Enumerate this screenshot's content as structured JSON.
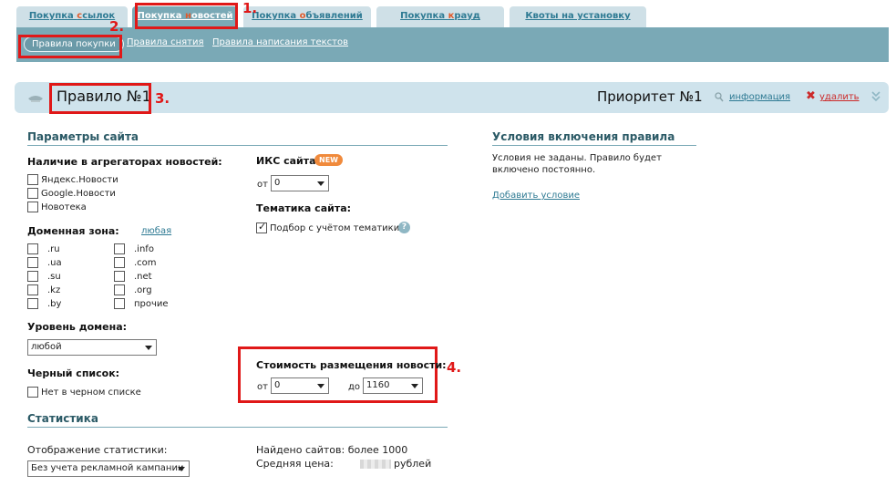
{
  "tabs": [
    {
      "pre": "Покупка ",
      "hl": "с",
      "post": "сылок"
    },
    {
      "pre": "Покупка ",
      "hl": "н",
      "post": "овостей"
    },
    {
      "pre": "Покупка ",
      "hl": "о",
      "post": "бъявлений"
    },
    {
      "pre": "Покупка ",
      "hl": "к",
      "post": "рауд"
    },
    {
      "pre": "Квоты на установку",
      "hl": "",
      "post": ""
    }
  ],
  "subnav": {
    "active": "Правила покупки",
    "items": [
      "Правила снятия",
      "Правила написания текстов"
    ]
  },
  "rule": {
    "title": "Правило №1",
    "priority": "Приоритет №1",
    "info_label": "информация",
    "delete_label": "удалить"
  },
  "annotations": [
    "1.",
    "2.",
    "3.",
    "4."
  ],
  "site_params": {
    "heading": "Параметры сайта",
    "aggregators_label": "Наличие в агрегаторах новостей:",
    "aggregators": [
      "Яндекс.Новости",
      "Google.Новости",
      "Новотека"
    ],
    "domain_zone_label": "Доменная зона:",
    "domain_zone_any": "любая",
    "zones_left": [
      ".ru",
      ".ua",
      ".su",
      ".kz",
      ".by"
    ],
    "zones_right": [
      ".info",
      ".com",
      ".net",
      ".org",
      "прочие"
    ],
    "domain_level_label": "Уровень домена:",
    "domain_level_value": "любой",
    "blacklist_label": "Черный список:",
    "blacklist_option": "Нет в черном списке",
    "iks_label": "ИКС сайта:",
    "iks_new_badge": "NEW",
    "iks_from_label": "от",
    "iks_from_value": "0",
    "topic_label": "Тематика сайта:",
    "topic_option": "Подбор с учётом тематики",
    "cost_label": "Стоимость размещения новости:",
    "cost_from_label": "от",
    "cost_from_value": "0",
    "cost_to_label": "до",
    "cost_to_value": "1160"
  },
  "conditions": {
    "heading": "Условия включения правила",
    "text_line1": "Условия не заданы. Правило будет",
    "text_line2": "включено постоянно.",
    "add_link": "Добавить условие"
  },
  "stats": {
    "heading": "Статистика",
    "display_label": "Отображение статистики:",
    "display_value": "Без учета рекламной кампании",
    "found_label": "Найдено сайтов: более 1000",
    "avg_price_label": "Средняя цена:",
    "avg_price_unit": "рублей"
  },
  "colors": {
    "accent": "#7aa9b6",
    "annotation": "#e01818",
    "link": "#2e7a93"
  }
}
